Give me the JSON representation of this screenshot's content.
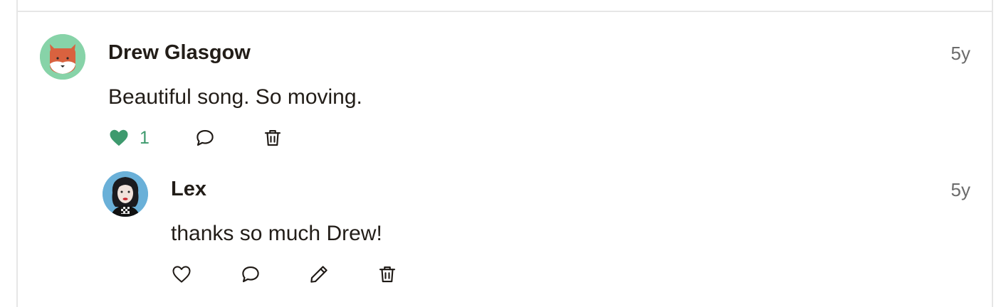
{
  "comments": [
    {
      "author": "Drew Glasgow",
      "time": "5y",
      "text": "Beautiful song. So moving.",
      "like_count": "1",
      "liked": true,
      "avatar_icon": "fox-avatar",
      "actions": [
        "heart-icon",
        "reply-icon",
        "trash-icon"
      ]
    },
    {
      "author": "Lex",
      "time": "5y",
      "text": "thanks so much Drew!",
      "liked": false,
      "avatar_icon": "user-photo-avatar",
      "actions": [
        "heart-icon",
        "reply-icon",
        "pencil-icon",
        "trash-icon"
      ]
    }
  ],
  "colors": {
    "accent_green": "#3e9a6e",
    "avatar_green": "#87d3a8",
    "fox_orange": "#d9623f",
    "photo_blue": "#6ab0d8"
  }
}
